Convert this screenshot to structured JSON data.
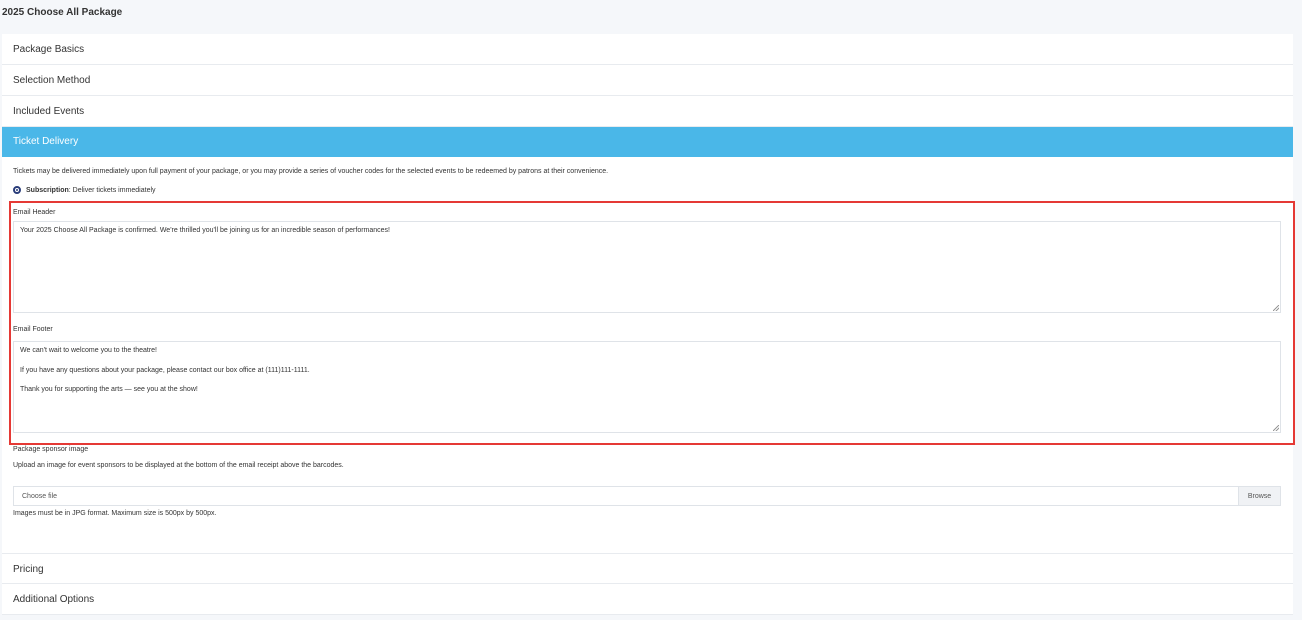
{
  "page_title": "2025 Choose All Package",
  "sections": {
    "package_basics": "Package Basics",
    "selection_method": "Selection Method",
    "included_events": "Included Events",
    "ticket_delivery": "Ticket Delivery",
    "pricing": "Pricing",
    "additional_options": "Additional Options"
  },
  "ticket_delivery": {
    "description": "Tickets may be delivered immediately upon full payment of your package, or you may provide a series of voucher codes for the selected events to be redeemed by patrons at their convenience.",
    "radio_option_bold": "Subscription",
    "radio_option_text": ": Deliver tickets immediately",
    "email_header_label": "Email Header",
    "email_header_value": "Your 2025 Choose All Package is confirmed. We're thrilled you'll be joining us for an incredible season of performances!",
    "email_footer_label": "Email Footer",
    "email_footer_line1": "We can't wait to welcome you to the theatre!",
    "email_footer_line2": "If you have any questions about your package, please contact our box office at (111)111-1111.",
    "email_footer_line3": "Thank you for supporting the arts — see you at the show!",
    "sponsor_image_label": "Package sponsor image",
    "sponsor_image_help": "Upload an image for event sponsors to be displayed at the bottom of the email receipt above the barcodes.",
    "file_placeholder": "Choose file",
    "browse_label": "Browse",
    "file_requirements": "Images must be in JPG format. Maximum size is 500px by 500px."
  },
  "colors": {
    "active_header": "#4ab7e8",
    "highlight_border": "#e53935",
    "radio": "#2a3d7a"
  }
}
